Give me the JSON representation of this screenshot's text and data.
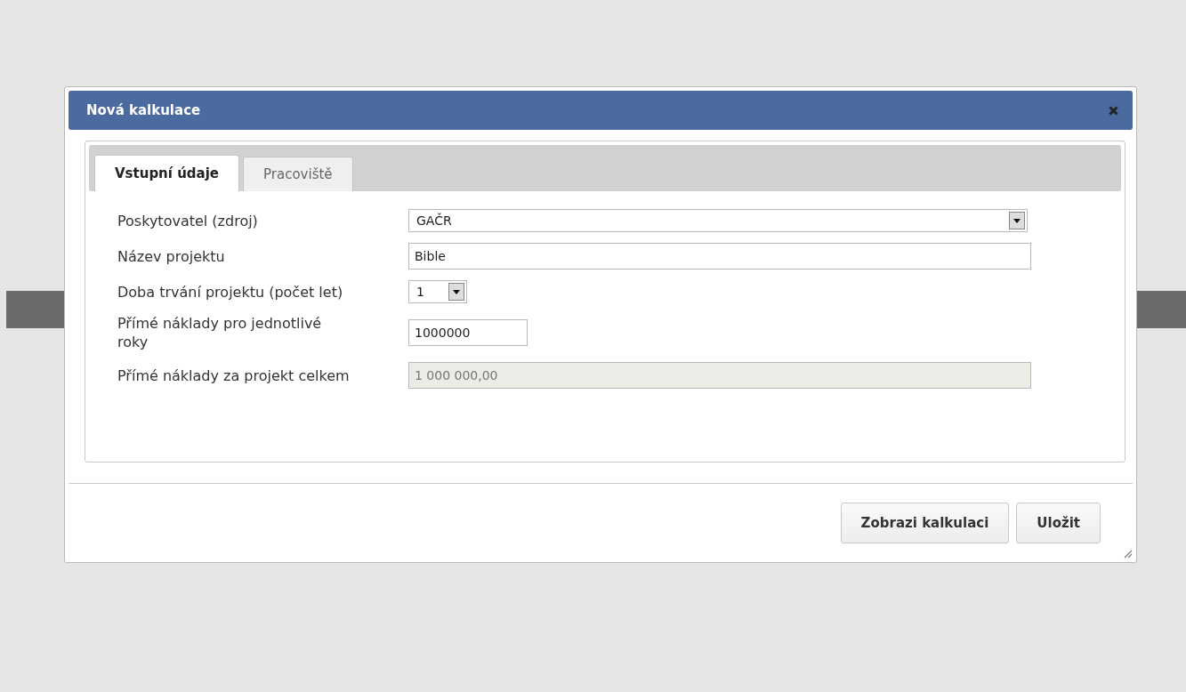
{
  "dialog": {
    "title": "Nová kalkulace"
  },
  "tabs": [
    {
      "label": "Vstupní údaje",
      "selected": true
    },
    {
      "label": "Pracoviště",
      "selected": false
    }
  ],
  "fields": [
    {
      "label": "Poskytovatel (zdroj)",
      "kind": "select",
      "value": "GAČR"
    },
    {
      "label": "Název projektu",
      "kind": "text",
      "value": "Bible"
    },
    {
      "label": "Doba trvání projektu (počet let)",
      "kind": "select",
      "value": "1"
    },
    {
      "label": "Přímé náklady pro jednotlivé roky",
      "kind": "text",
      "value": "1000000"
    },
    {
      "label": "Přímé náklady za projekt celkem",
      "kind": "text",
      "value": "1 000 000,00",
      "disabled": true
    }
  ],
  "buttons": [
    "Zobrazi kalkulaci",
    "Uložit"
  ]
}
